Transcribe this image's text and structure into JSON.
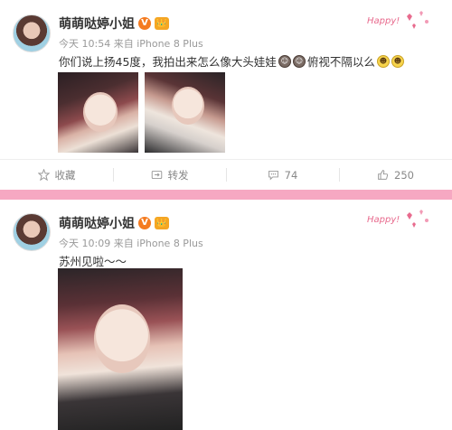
{
  "posts": [
    {
      "username": "萌萌哒婷小姐",
      "verified_badge": "V",
      "crown_badge": "👑",
      "meta": "今天 10:54 来自 iPhone 8 Plus",
      "text": "你们说上扬45度，我拍出来怎么像大头娃娃",
      "text_after": "俯视不隔以么",
      "actions": [
        {
          "label": "收藏",
          "icon": "star-icon"
        },
        {
          "label": "转发",
          "icon": "repost-icon"
        },
        {
          "label": "74",
          "icon": "comment-icon"
        },
        {
          "label": "250",
          "icon": "thumbs-up-icon"
        }
      ]
    },
    {
      "username": "萌萌哒婷小姐",
      "verified_badge": "V",
      "crown_badge": "👑",
      "meta": "今天 10:09 来自 iPhone 8 Plus",
      "text": "苏州见啦～～"
    }
  ],
  "decoration": {
    "happy_text": "Happy!"
  },
  "colors": {
    "page_bg": "#f6a8c2",
    "accent": "#f47b20"
  }
}
